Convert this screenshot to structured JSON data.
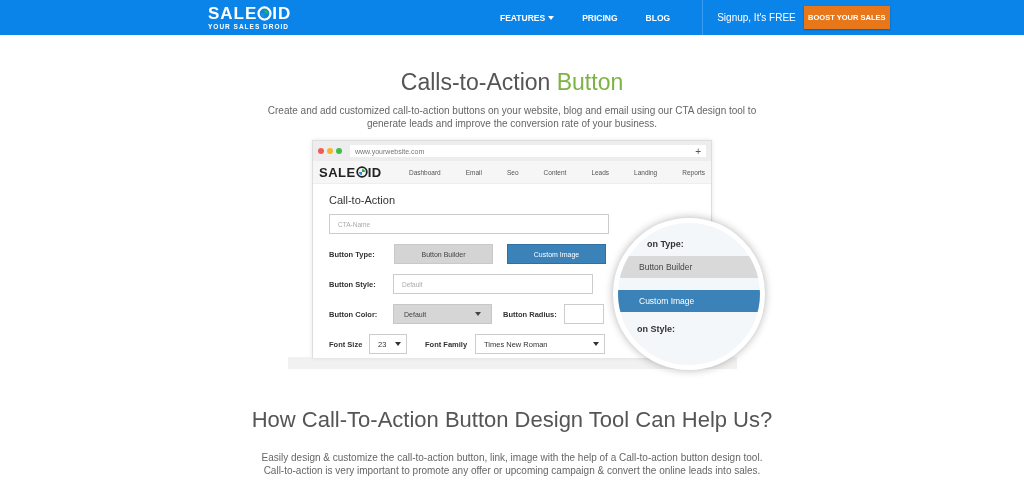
{
  "header": {
    "logo": {
      "left": "SALE",
      "right": "ID",
      "tagline": "YOUR SALES DROID"
    },
    "nav": [
      {
        "label": "FEATURES",
        "dropdown": true
      },
      {
        "label": "PRICING",
        "dropdown": false
      },
      {
        "label": "BLOG",
        "dropdown": false
      }
    ],
    "signup": "Signup, It's FREE",
    "cta": "BOOST YOUR SALES"
  },
  "hero": {
    "title": "Calls-to-Action",
    "title_accent": "Button",
    "subtitle": "Create and add customized call-to-action buttons on your website, blog and email using our CTA design tool to generate leads and improve the conversion rate of your business."
  },
  "mockup": {
    "url": "www.yourwebsite.com",
    "plus": "+",
    "logo": {
      "left": "SALE",
      "right": "ID"
    },
    "menu": [
      "Dashboard",
      "Email",
      "Seo",
      "Content",
      "Leads",
      "Landing",
      "Reports"
    ],
    "form_title": "Call-to-Action",
    "name_placeholder": "CTA-Name",
    "button_type_label": "Button Type:",
    "button_types": [
      {
        "label": "Button Builder",
        "selected": false
      },
      {
        "label": "Custom Image",
        "selected": true
      }
    ],
    "button_style_label": "Button Style:",
    "button_style_placeholder": "Default",
    "button_color_label": "Button Color:",
    "button_color_value": "Default",
    "button_radius_label": "Button Radius:",
    "font_size_label": "Font Size",
    "font_size_value": "23",
    "font_family_label": "Font Family",
    "font_family_value": "Times New Roman",
    "magnifier": {
      "type_label": "on Type:",
      "options": [
        {
          "label": "Button Builder",
          "selected": false
        },
        {
          "label": "Custom Image",
          "selected": true
        }
      ],
      "style_label": "on Style:"
    }
  },
  "info": {
    "title": "How Call-To-Action Button Design Tool Can Help Us?",
    "text": "Easily design & customize the call-to-action button, link, image with the help of a Call-to-action button design tool. Call-to-action is very important to promote any offer or upcoming campaign & convert the online leads into sales."
  }
}
